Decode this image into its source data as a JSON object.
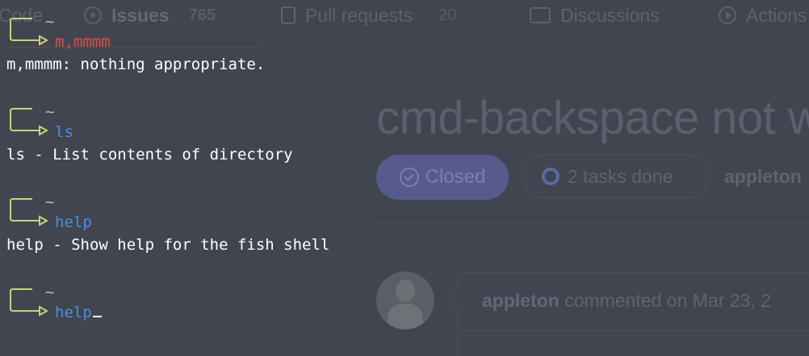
{
  "background": {
    "tabs": [
      {
        "label": "Code",
        "count": ""
      },
      {
        "label": "Issues",
        "count": "765"
      },
      {
        "label": "Pull requests",
        "count": "20"
      },
      {
        "label": "Discussions",
        "count": ""
      },
      {
        "label": "Actions",
        "count": ""
      }
    ],
    "issue_title": "cmd-backspace not working",
    "status": "Closed",
    "tasks": "2 tasks done",
    "author": "appleton",
    "comment_author": "appleton",
    "comment_text": "commented on Mar 23, 2"
  },
  "terminal": {
    "prompt_dir": "~",
    "entries": [
      {
        "command": "m,mmmm",
        "output": "m,mmmm: nothing appropriate."
      },
      {
        "command": "ls",
        "output": "ls - List contents of directory"
      },
      {
        "command": "help",
        "output": "help - Show help for the fish shell"
      }
    ],
    "current_command": "help"
  },
  "colors": {
    "error_command": "#e04e4e",
    "valid_command": "#4a8fe0",
    "prompt_arrow": "#c8d27a",
    "output_text": "#ffffff"
  }
}
